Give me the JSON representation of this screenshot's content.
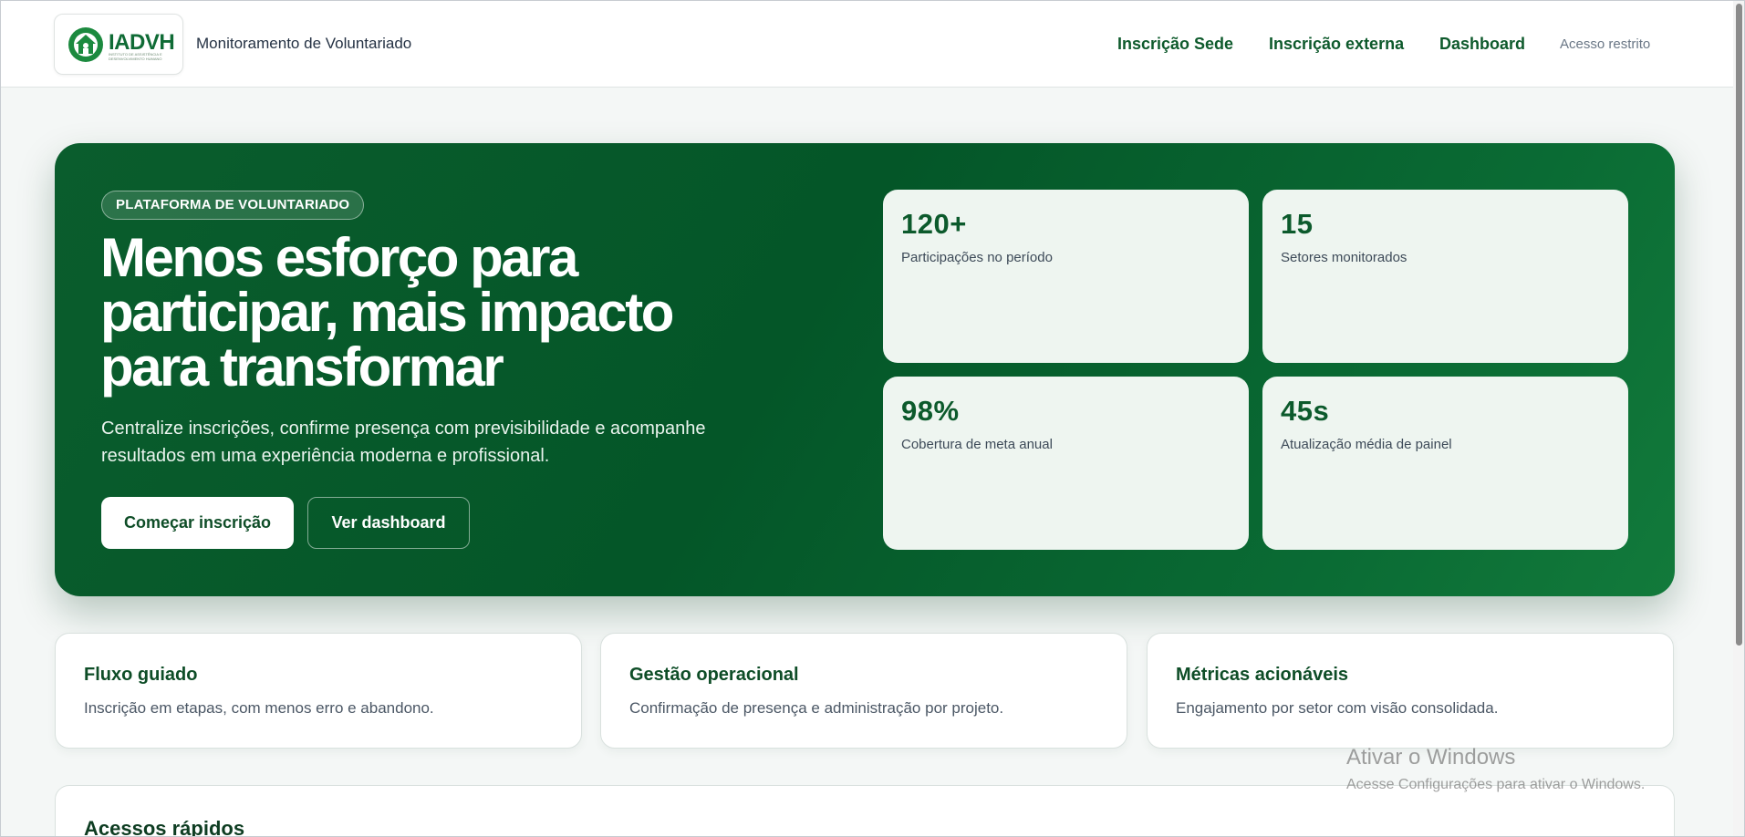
{
  "header": {
    "logo_text": "IADVH",
    "logo_subtitle": "INSTITUTO DE ASSISTÊNCIA E DESENVOLVIMENTO HUMANO",
    "app_title": "Monitoramento de Voluntariado",
    "nav": [
      "Inscrição Sede",
      "Inscrição externa",
      "Dashboard"
    ],
    "restricted_link": "Acesso restrito"
  },
  "hero": {
    "badge": "PLATAFORMA DE VOLUNTARIADO",
    "title": "Menos esforço para participar, mais impacto para transformar",
    "description": "Centralize inscrições, confirme presença com previsibilidade e acompanhe resultados em uma experiência moderna e profissional.",
    "primary_button": "Começar inscrição",
    "secondary_button": "Ver dashboard",
    "stats": [
      {
        "value": "120+",
        "label": "Participações no período"
      },
      {
        "value": "15",
        "label": "Setores monitorados"
      },
      {
        "value": "98%",
        "label": "Cobertura de meta anual"
      },
      {
        "value": "45s",
        "label": "Atualização média de painel"
      }
    ]
  },
  "features": [
    {
      "title": "Fluxo guiado",
      "description": "Inscrição em etapas, com menos erro e abandono."
    },
    {
      "title": "Gestão operacional",
      "description": "Confirmação de presença e administração por projeto."
    },
    {
      "title": "Métricas acionáveis",
      "description": "Engajamento por setor com visão consolidada."
    }
  ],
  "quick_access": {
    "title": "Acessos rápidos"
  },
  "windows_watermark": {
    "title": "Ativar o Windows",
    "subtitle": "Acesse Configurações para ativar o Windows."
  },
  "colors": {
    "brand_green": "#0e5a2c",
    "hero_background": "#045628",
    "stat_card": "#eef5f0"
  }
}
